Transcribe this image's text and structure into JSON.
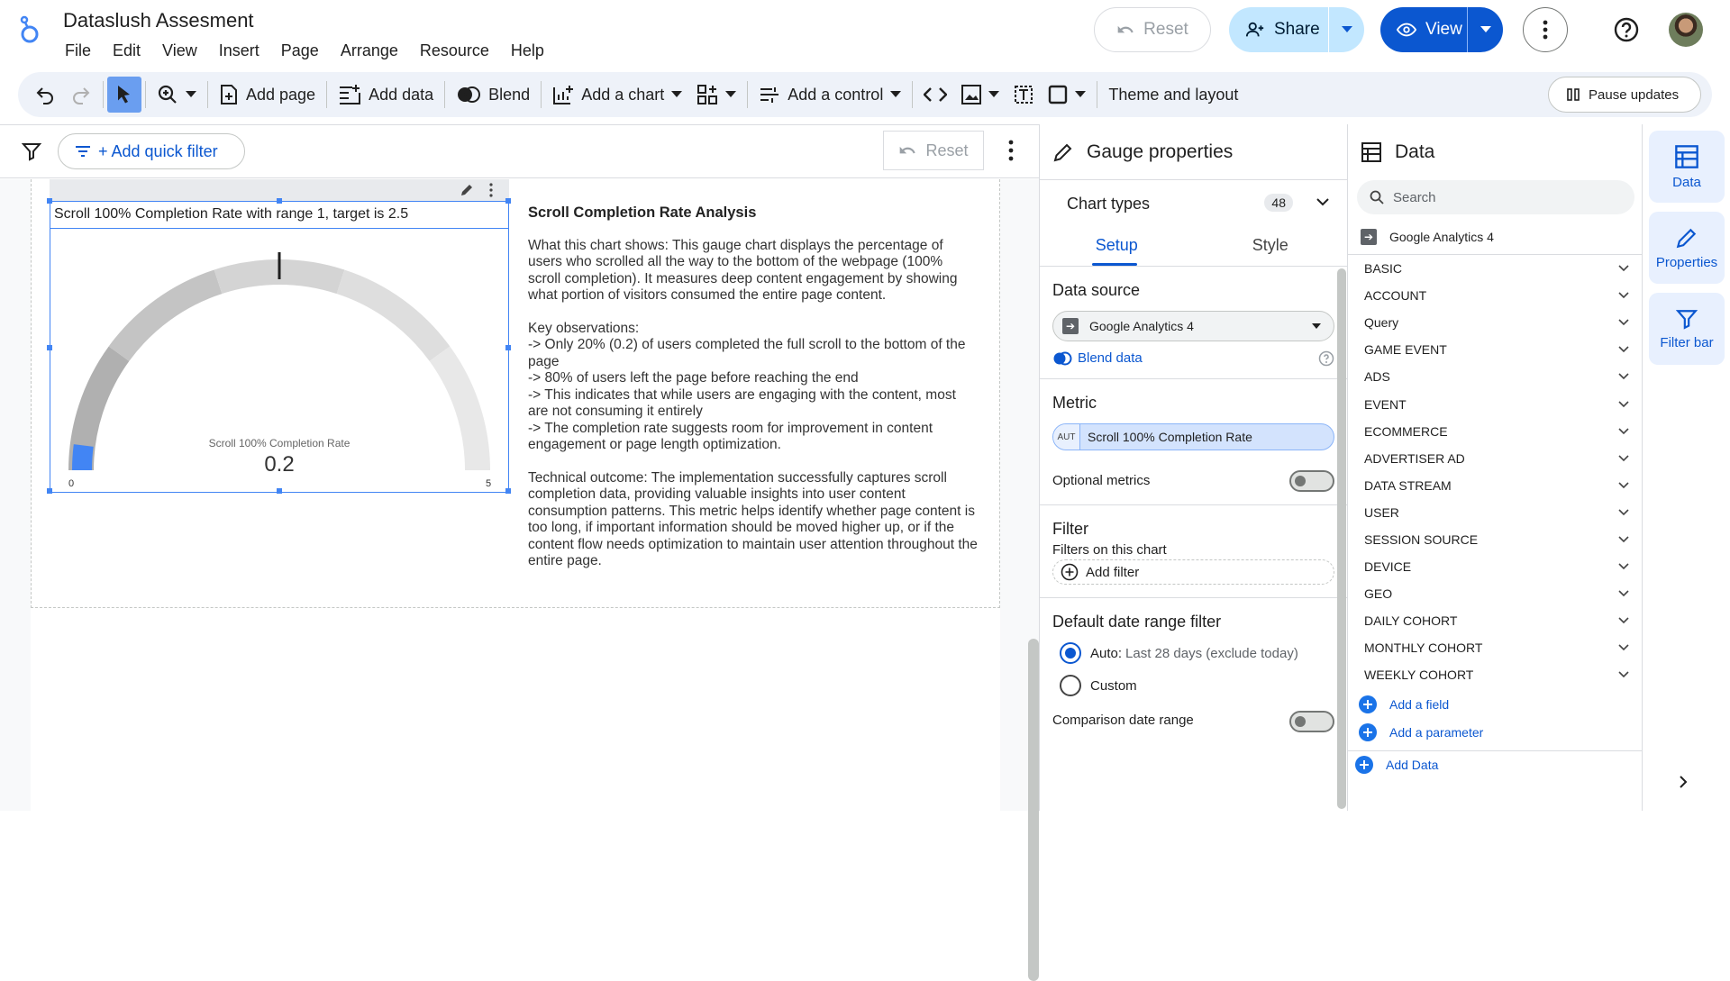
{
  "header": {
    "title": "Dataslush Assesment",
    "menu": [
      "File",
      "Edit",
      "View",
      "Insert",
      "Page",
      "Arrange",
      "Resource",
      "Help"
    ],
    "reset_label": "Reset",
    "share_label": "Share",
    "view_label": "View"
  },
  "toolbar": {
    "add_page": "Add page",
    "add_data": "Add data",
    "blend": "Blend",
    "add_chart": "Add a chart",
    "add_control": "Add a control",
    "theme": "Theme and layout",
    "pause": "Pause updates"
  },
  "filterbar": {
    "quick_filter": "+ Add quick filter",
    "reset": "Reset"
  },
  "chart": {
    "title": "Scroll 100% Completion Rate with range 1, target is 2.5",
    "metric_label": "Scroll 100% Completion Rate",
    "value_text": "0.2",
    "min_label": "0",
    "max_label": "5"
  },
  "chart_data": {
    "type": "gauge",
    "value": 0.2,
    "min": 0,
    "max": 5,
    "target": 2.5,
    "metric": "Scroll 100% Completion Rate"
  },
  "analysis": {
    "heading": "Scroll Completion Rate Analysis",
    "p1": "What this chart shows: This gauge chart displays the percentage of users who scrolled all the way to the bottom of the webpage (100% scroll completion). It measures deep content engagement by showing what portion of visitors consumed the entire page content.",
    "p2_head": "Key observations:",
    "p2_lines": [
      "-> Only 20% (0.2) of users completed the full scroll to the bottom of the page",
      "-> 80% of users left the page before reaching the end",
      "-> This indicates that while users are engaging with the content, most are not consuming it entirely",
      "-> The completion rate suggests room for improvement in content engagement or page length optimization."
    ],
    "p3": "Technical outcome: The implementation successfully captures scroll completion data, providing valuable insights into user content consumption patterns. This metric helps identify whether page content is too long, if important information should be moved higher up, or if the content flow needs optimization to maintain user attention throughout the entire page."
  },
  "props": {
    "title": "Gauge properties",
    "chart_types": "Chart types",
    "chart_types_count": "48",
    "tab_setup": "Setup",
    "tab_style": "Style",
    "data_source_head": "Data source",
    "data_source": "Google Analytics 4",
    "blend_data": "Blend data",
    "metric_head": "Metric",
    "metric_tag": "AUT",
    "metric": "Scroll 100% Completion Rate",
    "optional_metrics": "Optional metrics",
    "filter_head": "Filter",
    "filters_on_chart": "Filters on this chart",
    "add_filter": "Add filter",
    "date_head": "Default date range filter",
    "auto_label": "Auto:",
    "auto_value": "Last 28 days (exclude today)",
    "custom_label": "Custom",
    "comparison": "Comparison date range"
  },
  "data_panel": {
    "title": "Data",
    "search_placeholder": "Search",
    "source": "Google Analytics 4",
    "groups": [
      "BASIC",
      "ACCOUNT",
      "Query",
      "GAME EVENT",
      "ADS",
      "EVENT",
      "ECOMMERCE",
      "ADVERTISER AD",
      "DATA STREAM",
      "USER",
      "SESSION SOURCE",
      "DEVICE",
      "GEO",
      "DAILY COHORT",
      "MONTHLY COHORT",
      "WEEKLY COHORT"
    ],
    "add_field": "Add a field",
    "add_parameter": "Add a parameter",
    "add_data": "Add Data"
  },
  "sidebar": {
    "data": "Data",
    "properties": "Properties",
    "filter_bar": "Filter bar"
  },
  "colors": {
    "accent": "#0b57d0",
    "gauge_track": "#e8e8e8",
    "gauge_fill": "#4285f4"
  }
}
